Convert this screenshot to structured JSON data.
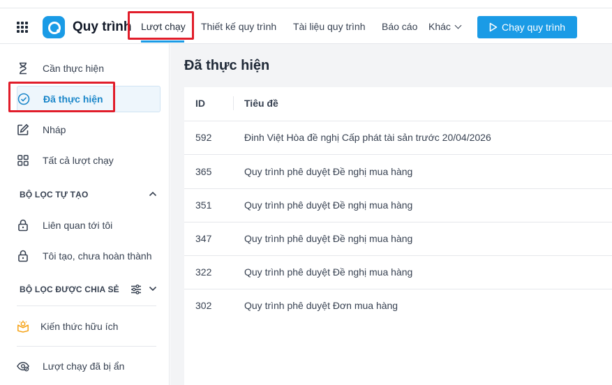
{
  "header": {
    "app_title": "Quy trình",
    "tabs": [
      {
        "label": "Lượt chạy",
        "active": true
      },
      {
        "label": "Thiết kế quy trình"
      },
      {
        "label": "Tài liệu quy trình"
      },
      {
        "label": "Báo cáo"
      },
      {
        "label": "Khác"
      }
    ],
    "run_button": "Chạy quy trình",
    "accent_color": "#1a9be6"
  },
  "sidebar": {
    "items": [
      {
        "label": "Cần thực hiện",
        "icon": "hourglass-icon"
      },
      {
        "label": "Đã thực hiện",
        "icon": "check-circle-icon",
        "active": true
      },
      {
        "label": "Nháp",
        "icon": "edit-icon"
      },
      {
        "label": "Tất cả lượt chạy",
        "icon": "grid-icon"
      }
    ],
    "custom_filters_heading": "BỘ LỌC TỰ TẠO",
    "custom_filters": [
      {
        "label": "Liên quan tới tôi",
        "icon": "lock-icon"
      },
      {
        "label": "Tôi tạo, chưa hoàn thành",
        "icon": "lock-icon"
      }
    ],
    "shared_filters_heading": "BỘ LỌC ĐƯỢC CHIA SẺ",
    "knowledge_label": "Kiến thức hữu ích",
    "hidden_runs_label": "Lượt chạy đã bị ẩn"
  },
  "main": {
    "title": "Đã thực hiện",
    "columns": [
      "ID",
      "Tiêu đề"
    ],
    "rows": [
      {
        "id": "592",
        "title": "Đinh Việt Hòa đề nghị Cấp phát tài sản trước 20/04/2026"
      },
      {
        "id": "365",
        "title": "Quy trình phê duyệt Đề nghị mua hàng"
      },
      {
        "id": "351",
        "title": "Quy trình phê duyệt Đề nghị mua hàng"
      },
      {
        "id": "347",
        "title": "Quy trình phê duyệt Đề nghị mua hàng"
      },
      {
        "id": "322",
        "title": "Quy trình phê duyệt Đề nghị mua hàng"
      },
      {
        "id": "302",
        "title": "Quy trình phê duyệt Đơn mua hàng"
      }
    ]
  }
}
